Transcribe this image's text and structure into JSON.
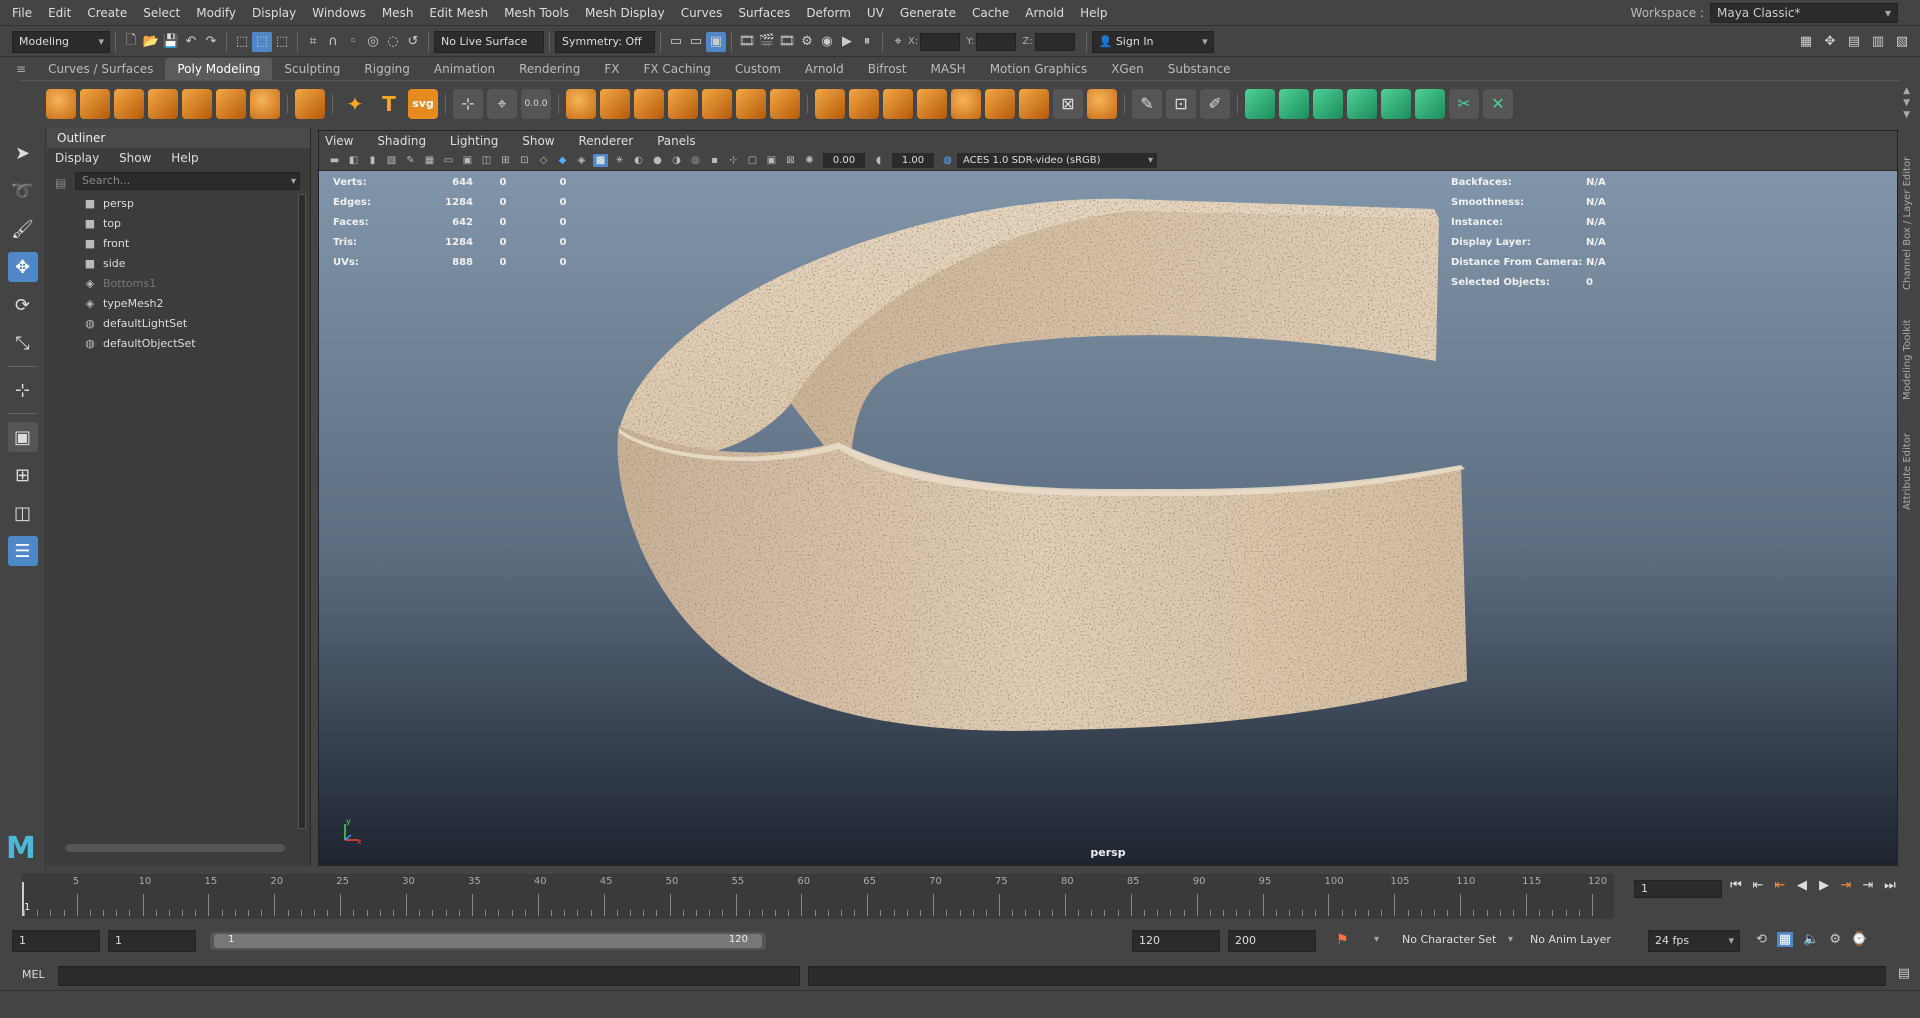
{
  "menubar": {
    "items": [
      "File",
      "Edit",
      "Create",
      "Select",
      "Modify",
      "Display",
      "Windows",
      "Mesh",
      "Edit Mesh",
      "Mesh Tools",
      "Mesh Display",
      "Curves",
      "Surfaces",
      "Deform",
      "UV",
      "Generate",
      "Cache",
      "Arnold",
      "Help"
    ]
  },
  "workspace": {
    "label": "Workspace :",
    "value": "Maya Classic*"
  },
  "statusline": {
    "mode": "Modeling",
    "live_surface": "No Live Surface",
    "symmetry": "Symmetry: Off",
    "x_label": "X:",
    "y_label": "Y:",
    "z_label": "Z:",
    "sign_in": "Sign In"
  },
  "shelf": {
    "tabs": [
      "Curves / Surfaces",
      "Poly Modeling",
      "Sculpting",
      "Rigging",
      "Animation",
      "Rendering",
      "FX",
      "FX Caching",
      "Custom",
      "Arnold",
      "Bifrost",
      "MASH",
      "Motion Graphics",
      "XGen",
      "Substance"
    ],
    "active_tab": "Poly Modeling",
    "svg_label": "svg",
    "type_label": "T",
    "counter_label": "0.0.0"
  },
  "outliner": {
    "title": "Outliner",
    "menu": [
      "Display",
      "Show",
      "Help"
    ],
    "search_placeholder": "Search...",
    "items": [
      {
        "label": "persp",
        "icon": "camera-icon"
      },
      {
        "label": "top",
        "icon": "camera-icon"
      },
      {
        "label": "front",
        "icon": "camera-icon"
      },
      {
        "label": "side",
        "icon": "camera-icon"
      },
      {
        "label": "Bottoms1",
        "icon": "mesh-icon"
      },
      {
        "label": "typeMesh2",
        "icon": "mesh-icon"
      },
      {
        "label": "defaultLightSet",
        "icon": "set-icon"
      },
      {
        "label": "defaultObjectSet",
        "icon": "set-icon"
      }
    ]
  },
  "viewport": {
    "menu": [
      "View",
      "Shading",
      "Lighting",
      "Show",
      "Renderer",
      "Panels"
    ],
    "exposure": "0.00",
    "gamma": "1.00",
    "color_space": "ACES 1.0 SDR-video (sRGB)",
    "camera": "persp",
    "hud_left": [
      {
        "label": "Verts:",
        "v1": "644",
        "v2": "0",
        "v3": "0"
      },
      {
        "label": "Edges:",
        "v1": "1284",
        "v2": "0",
        "v3": "0"
      },
      {
        "label": "Faces:",
        "v1": "642",
        "v2": "0",
        "v3": "0"
      },
      {
        "label": "Tris:",
        "v1": "1284",
        "v2": "0",
        "v3": "0"
      },
      {
        "label": "UVs:",
        "v1": "888",
        "v2": "0",
        "v3": "0"
      }
    ],
    "hud_right": [
      {
        "label": "Backfaces:",
        "value": "N/A"
      },
      {
        "label": "Smoothness:",
        "value": "N/A"
      },
      {
        "label": "Instance:",
        "value": "N/A"
      },
      {
        "label": "Display Layer:",
        "value": "N/A"
      },
      {
        "label": "Distance From Camera:",
        "value": "N/A"
      },
      {
        "label": "Selected Objects:",
        "value": "0"
      }
    ],
    "axis_y": "y",
    "axis_x": "x"
  },
  "side_tabs": [
    "Channel Box / Layer Editor",
    "Modeling Toolkit",
    "Attribute Editor"
  ],
  "timeline": {
    "ticks": [
      "5",
      "10",
      "15",
      "20",
      "25",
      "30",
      "35",
      "40",
      "45",
      "50",
      "55",
      "60",
      "65",
      "70",
      "75",
      "80",
      "85",
      "90",
      "95",
      "100",
      "105",
      "110",
      "115",
      "120"
    ],
    "current_marker": "1",
    "current_frame": "1"
  },
  "range": {
    "start": "1",
    "anim_start": "1",
    "slider_start": "1",
    "slider_end": "120",
    "end": "120",
    "anim_end": "200",
    "character_set": "No Character Set",
    "anim_layer": "No Anim Layer",
    "fps": "24 fps"
  },
  "cmdline": {
    "label": "MEL"
  },
  "colors": {
    "accent": "#4f87c7",
    "shelf_orange": "#f0a030",
    "shelf_green": "#3fbf86"
  }
}
